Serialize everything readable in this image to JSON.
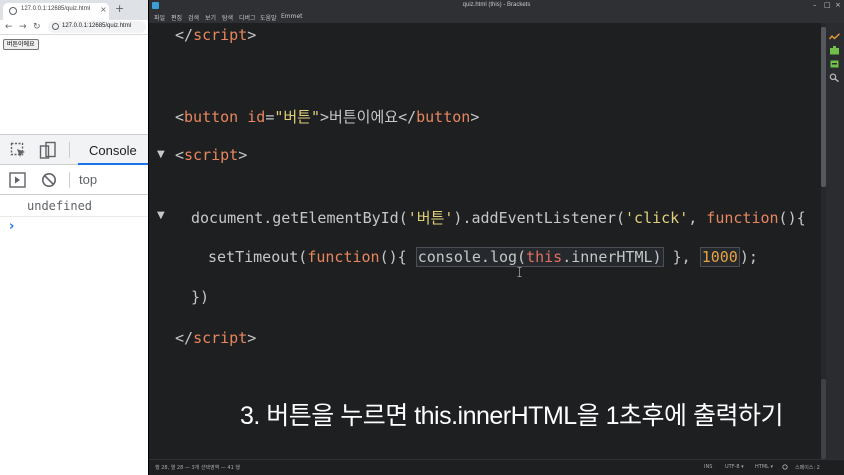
{
  "browser": {
    "tab": {
      "title": "127.0.0.1:12685/quiz.html",
      "close": "×",
      "new_tab": "+"
    },
    "nav": {
      "back": "←",
      "forward": "→",
      "reload": "↻"
    },
    "address": {
      "url": "127.0.0.1:12685/quiz.html"
    },
    "page": {
      "button_label": "버튼이에요"
    },
    "devtools": {
      "tab_console": "Console",
      "context": "top",
      "output": "undefined",
      "prompt": "›"
    }
  },
  "editor_window": {
    "title": "quiz.html (this) - Brackets",
    "controls": {
      "minimize": "–",
      "maximize": "□",
      "close": "×"
    },
    "menu": [
      "파일",
      "편집",
      "검색",
      "보기",
      "탐색",
      "디버그",
      "도움말",
      "Emmet"
    ],
    "code": {
      "l1": {
        "open": "</",
        "tag": "script",
        "close": ">"
      },
      "l2": {
        "lt": "<",
        "tag": "button",
        "sp": " ",
        "attr": "id",
        "eq": "=",
        "val": "\"버튼\"",
        "gt": ">",
        "text": "버튼이에요",
        "lt2": "</",
        "tag2": "button",
        "gt2": ">"
      },
      "l3": {
        "lt": "<",
        "tag": "script",
        "gt": ">"
      },
      "l4": {
        "obj": "document.getElementById(",
        "arg1": "'버튼'",
        "mid": ").addEventListener(",
        "arg2": "'click'",
        "comma": ", ",
        "kw": "function",
        "tail": "(){"
      },
      "l5": {
        "call": "setTimeout(",
        "kw": "function",
        "open": "(){ ",
        "log": "console.log(",
        "this": "this",
        "prop": ".innerHTML)",
        "rest": " }, ",
        "num": "1000",
        "end": ");"
      },
      "l6": {
        "text": "})"
      },
      "l7": {
        "open": "</",
        "tag": "script",
        "close": ">"
      }
    },
    "fold_markers": [
      "▼",
      "▼"
    ],
    "caption": "3. 버튼을 누르면 this.innerHTML을 1초후에 출력하기",
    "status": {
      "position": "행 28, 열 28 — 3개 선택영역 — 41 행",
      "ins": "INS",
      "encoding": "UTF-8 ▾",
      "language": "HTML ▾",
      "spaces": "스페이스: 2"
    }
  },
  "colors": {
    "editor_bg": "#1d1f21",
    "tag": "#e8865e",
    "string": "#e3d07a",
    "number": "#e6a342",
    "this_keyword": "#e36f61",
    "console_tab_accent": "#1a73e8"
  }
}
